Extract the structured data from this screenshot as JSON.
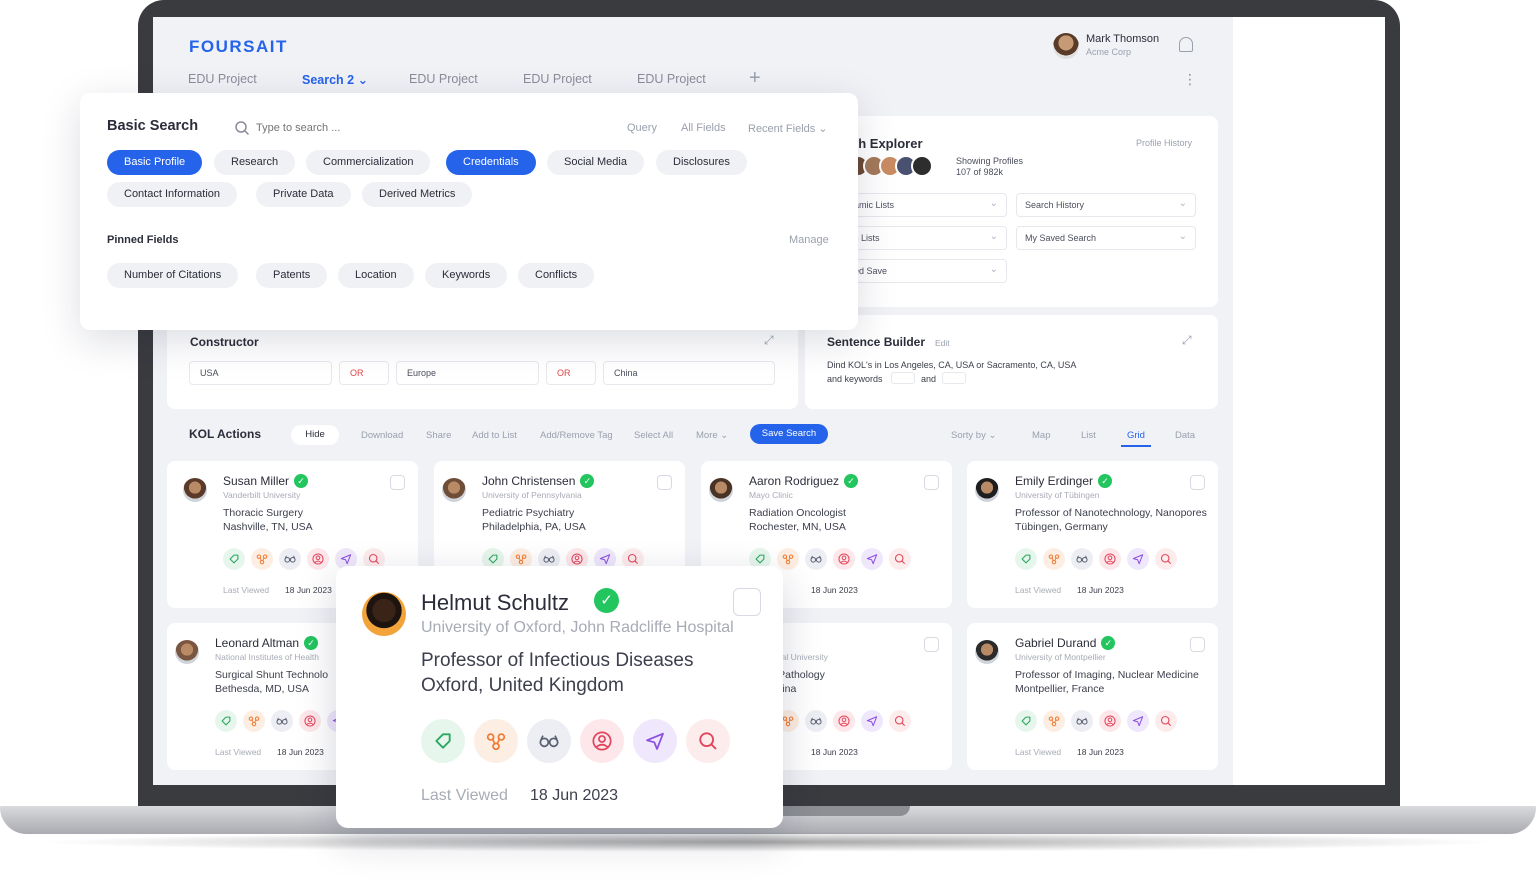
{
  "app": {
    "logo": "FOURSAIT"
  },
  "user": {
    "name": "Mark Thomson",
    "org": "Acme Corp"
  },
  "tabs": [
    {
      "label": "EDU Project"
    },
    {
      "label": "Search 2 ⌄"
    },
    {
      "label": "EDU Project"
    },
    {
      "label": "EDU Project"
    },
    {
      "label": "EDU Project"
    }
  ],
  "explorer": {
    "title": "ch Explorer",
    "history": "Profile History",
    "showing_label": "Showing Profiles",
    "showing_count": "107 of 982k",
    "selects": {
      "dynamic_lists": "amic Lists",
      "search_history": "Search History",
      "static_lists": "c Lists",
      "my_saved_search": "My Saved Search",
      "saved": "ed Save"
    }
  },
  "constructor": {
    "title": "Constructor",
    "fields": [
      "USA",
      "OR",
      "Europe",
      "OR",
      "China"
    ]
  },
  "sentence_builder": {
    "title": "Sentence Builder",
    "edit": "Edit",
    "line1": "Dind KOL's in Los Angeles, CA, USA or Sacramento, CA, USA",
    "line2a": "and keywords",
    "line2b": "and"
  },
  "kol_actions": {
    "title": "KOL Actions",
    "hide": "Hide",
    "download": "Download",
    "share": "Share",
    "add_to_list": "Add to List",
    "add_remove_tag": "Add/Remove Tag",
    "select_all": "Select All",
    "more": "More ⌄",
    "save_search": "Save Search",
    "sort_by": "Sorty by ⌄",
    "map": "Map",
    "list": "List",
    "grid": "Grid",
    "data": "Data"
  },
  "kol_cards": [
    {
      "name": "Susan Miller",
      "uni": "Vanderbilt University",
      "role": "Thoracic Surgery",
      "loc": "Nashville, TN, USA",
      "last_viewed_label": "Last Viewed",
      "date": "18 Jun 2023"
    },
    {
      "name": "John Christensen",
      "uni": "University of Pennsylvania",
      "role": "Pediatric Psychiatry",
      "loc": "Philadelphia, PA, USA",
      "last_viewed_label": "",
      "date": ""
    },
    {
      "name": "Aaron Rodriguez",
      "uni": "Mayo Clinic",
      "role": "Radiation Oncologist",
      "loc": "Rochester, MN, USA",
      "last_viewed_label": "wed",
      "date": "18 Jun 2023"
    },
    {
      "name": "Emily Erdinger",
      "uni": "University of Tübingen",
      "role": "Professor of Nanotechnology, Nanopores",
      "loc": "Tübingen, Germany",
      "last_viewed_label": "Last Viewed",
      "date": "18 Jun 2023"
    },
    {
      "name": "Leonard Altman",
      "uni": "National Institutes of Health",
      "role": "Surgical Shunt Technolo",
      "loc": "Bethesda, MD, USA",
      "last_viewed_label": "Last Viewed",
      "date": "18 Jun 2023"
    },
    {
      "name": "ng",
      "uni": "na Normal University",
      "role": "sor of Pathology",
      "loc": "hai, China",
      "last_viewed_label": "wed",
      "date": "18 Jun 2023"
    },
    {
      "name": "Gabriel Durand",
      "uni": "University of Montpellier",
      "role": "Professor of Imaging, Nuclear Medicine",
      "loc": "Montpellier, France",
      "last_viewed_label": "Last Viewed",
      "date": "18 Jun 2023"
    }
  ],
  "basic_search": {
    "title": "Basic Search",
    "placeholder": "Type to search ...",
    "query": "Query",
    "all_fields": "All Fields",
    "recent_fields": "Recent Fields ⌄",
    "chips": [
      "Basic Profile",
      "Research",
      "Commercialization",
      "Credentials",
      "Social Media",
      "Disclosures",
      "Contact Information",
      "Private Data",
      "Derived Metrics"
    ],
    "pinned_title": "Pinned Fields",
    "manage": "Manage",
    "pinned": [
      "Number of Citations",
      "Patents",
      "Location",
      "Keywords",
      "Conflicts"
    ]
  },
  "featured": {
    "name": "Helmut Schultz",
    "affiliation": "University of Oxford, John Radcliffe Hospital",
    "role": "Professor of Infectious Diseases",
    "location": "Oxford, United Kingdom",
    "last_viewed_label": "Last Viewed",
    "date": "18 Jun 2023"
  },
  "icons": [
    "tag-icon",
    "network-icon",
    "glasses-icon",
    "profile-icon",
    "send-icon",
    "search-icon"
  ],
  "colors": {
    "accent": "#2563eb",
    "verified": "#22c55e"
  }
}
